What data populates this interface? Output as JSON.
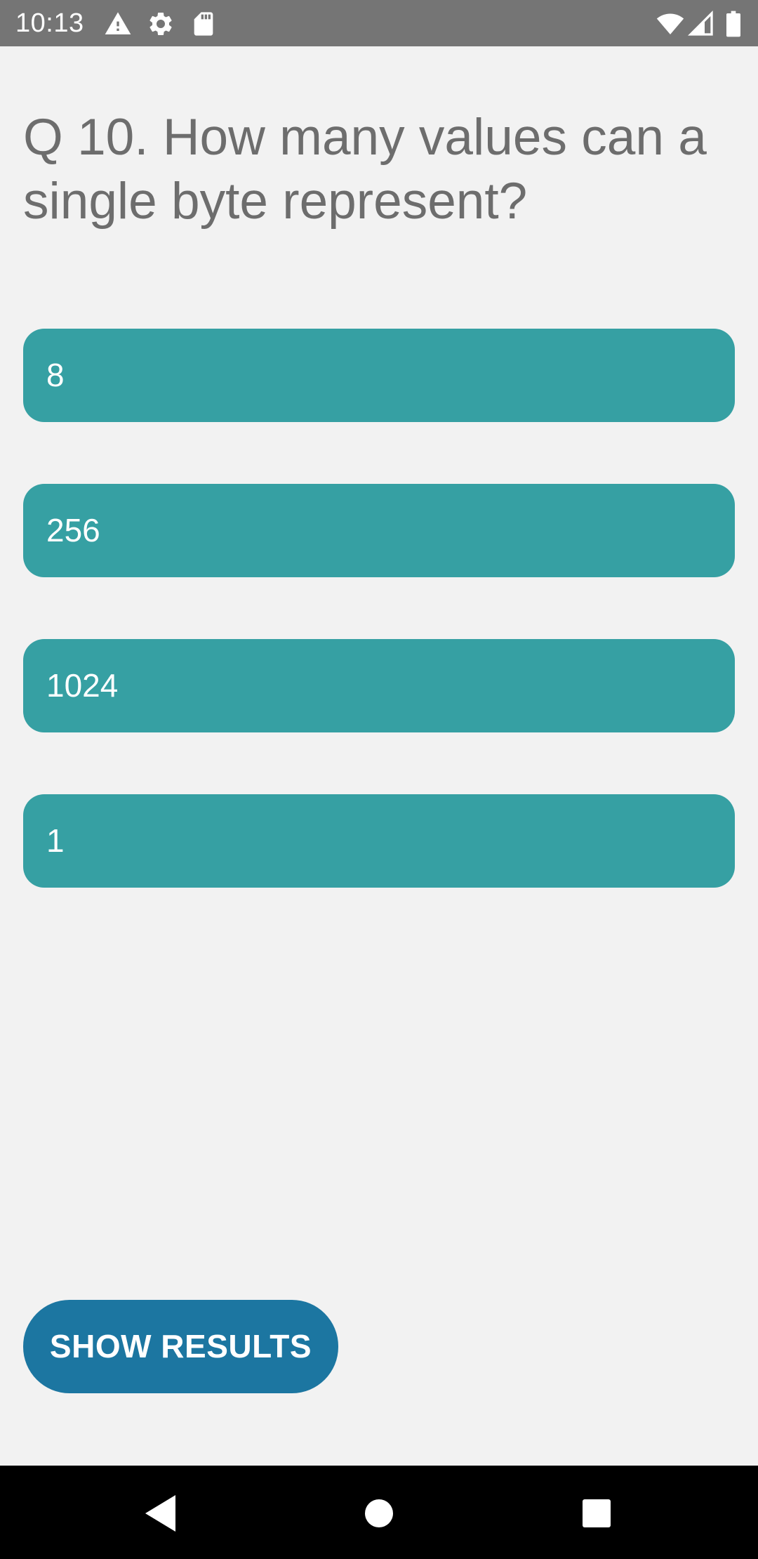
{
  "status_bar": {
    "time": "10:13",
    "icons_left": [
      "warning-icon",
      "settings-icon",
      "sd-card-icon"
    ],
    "icons_right": [
      "wifi-icon",
      "cell-signal-icon",
      "battery-icon"
    ],
    "background": "#757575"
  },
  "quiz": {
    "question": "Q 10. How many values can a single byte represent?",
    "answers": [
      {
        "label": "8"
      },
      {
        "label": "256"
      },
      {
        "label": "1024"
      },
      {
        "label": "1"
      }
    ],
    "answer_color": "#36a0a3",
    "show_results_label": "SHOW RESULTS",
    "show_results_color": "#1c76a1"
  },
  "nav_bar": {
    "buttons": [
      "back-icon",
      "home-icon",
      "recents-icon"
    ]
  }
}
